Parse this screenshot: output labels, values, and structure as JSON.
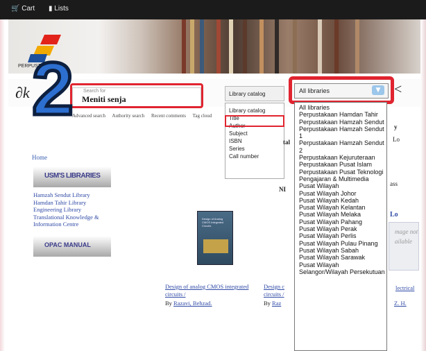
{
  "topbar": {
    "cart_label": "Cart",
    "lists_label": "Lists"
  },
  "banner": {
    "logo_text": "PERPUSTAKAAN"
  },
  "annotation": {
    "step_number": "2"
  },
  "logo": {
    "text": "k"
  },
  "search": {
    "value": "Meniti senja",
    "ghost_text": "Search for",
    "catalog_selected": "Library catalog",
    "catalog_options": [
      "Library catalog",
      "Title",
      "Author",
      "Subject",
      "ISBN",
      "Series",
      "Call number"
    ],
    "library_selected": "All libraries",
    "library_options": [
      "All libraries",
      "Perpustakaan Hamdan Tahir",
      "Perpustakaan Hamzah Sendut",
      "Perpustakaan Hamzah Sendut 1",
      "Perpustakaan Hamzah Sendut 2",
      "Perpustakaan Kejuruteraan",
      "Perpustakaan Pusat Islam",
      "Perpustakaan Pusat Teknologi Pengajaran & Multimedia",
      "Pusat Wilayah",
      "Pusat Wilayah Johor",
      "Pusat Wilayah Kedah",
      "Pusat Wilayah Kelantan",
      "Pusat Wilayah Melaka",
      "Pusat Wilayah Pahang",
      "Pusat Wilayah Perak",
      "Pusat Wilayah Perlis",
      "Pusat Wilayah Pulau Pinang",
      "Pusat Wilayah Sabah",
      "Pusat Wilayah Sarawak",
      "Pusat Wilayah Selangor/Wilayah Persekutuan"
    ]
  },
  "nav_links": [
    "Advanced search",
    "Authority search",
    "Recent comments",
    "Tag cloud"
  ],
  "sidebar": {
    "home": "Home",
    "usm_heading": "USM'S LIBRARIES",
    "libraries": [
      "Hamzah Sendut Library",
      "Hamdan Tahir Library",
      "Engineering Library",
      "Translational Knowledge & Information Centre"
    ],
    "opac_heading": "OPAC MANUAL"
  },
  "book": {
    "cover_title": "Design of Analog CMOS Integrated Circuits",
    "title": "Design of analog CMOS integrated circuits /",
    "by_label": "By",
    "author": "Razavi, Behzad."
  },
  "book2": {
    "title": "Design c",
    "title2": "circuits /",
    "by_label": "By",
    "author": "Raz"
  },
  "fragments": {
    "tal": "tal",
    "ni": "NI",
    "y": "y",
    "lo": "Lo",
    "ass": "ass",
    "lo2": "Lo",
    "no_image": "mage not ailable",
    "elec": "lectrical",
    "zh": "Z. H.",
    "k": "<"
  }
}
